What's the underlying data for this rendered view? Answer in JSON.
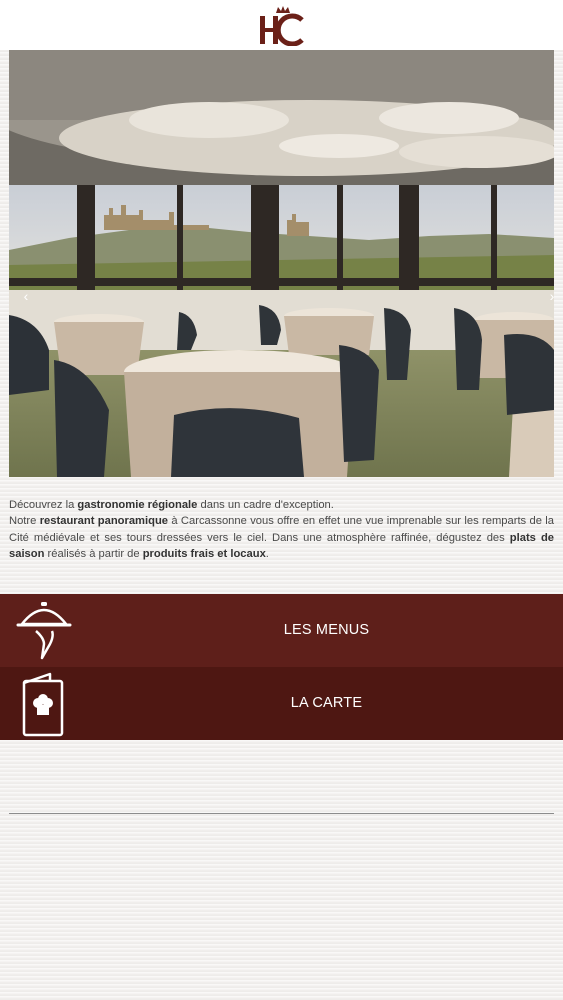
{
  "brand": {
    "logo_text": "HC",
    "accent": "#6b2018"
  },
  "hero": {
    "prev_icon": "chevron-left-icon",
    "next_icon": "chevron-right-icon"
  },
  "intro": {
    "l1a": "Découvrez la ",
    "l1b": "gastronomie régionale",
    "l1c": " dans un cadre d'exception.",
    "l2a": "Notre ",
    "l2b": "restaurant panoramique",
    "l2c": " à Carcassonne vous offre en effet une vue imprenable sur les remparts de la Cité médiévale et ses tours dressées vers le ciel. Dans une atmosphère raffinée, dégustez des ",
    "l2d": "plats de saison",
    "l2e": " réalisés à partir de ",
    "l2f": "produits frais et locaux",
    "l2g": "."
  },
  "menu": {
    "menus_label": "LES MENUS",
    "carte_label": "LA CARTE",
    "menus_icon": "cloche-icon",
    "carte_icon": "menu-card-icon",
    "menus_bg": "#5e1f1a",
    "carte_bg": "#4e1712"
  }
}
